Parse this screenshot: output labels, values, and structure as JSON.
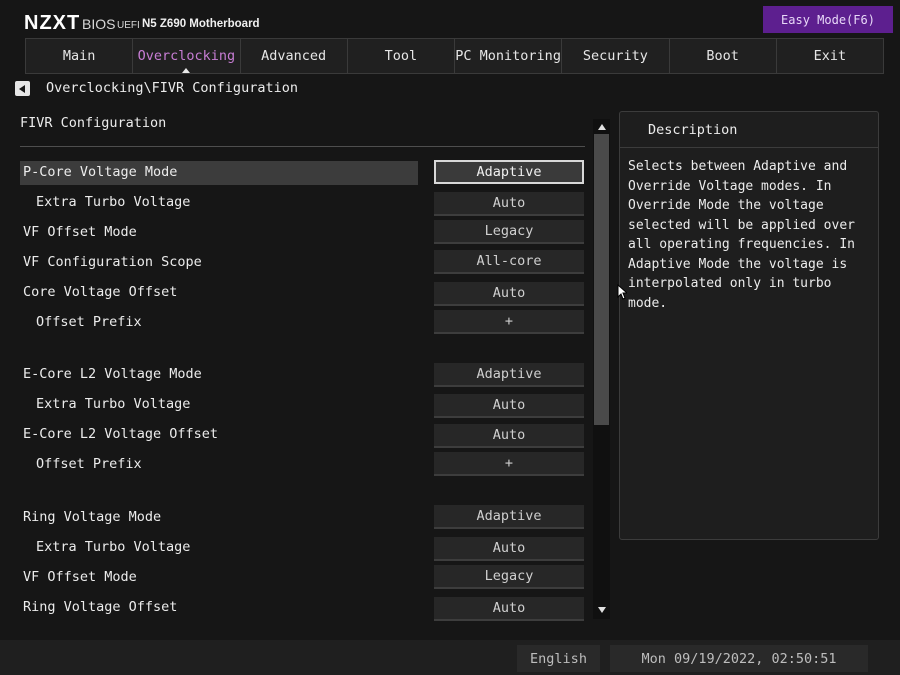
{
  "header": {
    "brand": "NZXT",
    "bios_word": "BIOS",
    "uefi": "UEFI",
    "model": "N5 Z690 Motherboard",
    "easy_mode": "Easy Mode(F6)"
  },
  "tabs": [
    {
      "label": "Main",
      "active": false
    },
    {
      "label": "Overclocking",
      "active": true
    },
    {
      "label": "Advanced",
      "active": false
    },
    {
      "label": "Tool",
      "active": false
    },
    {
      "label": "PC Monitoring",
      "active": false
    },
    {
      "label": "Security",
      "active": false
    },
    {
      "label": "Boot",
      "active": false
    },
    {
      "label": "Exit",
      "active": false
    }
  ],
  "breadcrumb": "Overclocking\\FIVR Configuration",
  "section_title": "FIVR Configuration",
  "settings": [
    {
      "label": "P-Core Voltage Mode",
      "value": "Adaptive",
      "selected": true
    },
    {
      "label": "Extra Turbo Voltage",
      "value": "Auto"
    },
    {
      "label": "VF Offset Mode",
      "value": "Legacy"
    },
    {
      "label": "VF Configuration Scope",
      "value": "All-core"
    },
    {
      "label": "Core Voltage Offset",
      "value": "Auto"
    },
    {
      "label": "Offset Prefix",
      "value": "+"
    },
    {
      "label": "E-Core L2 Voltage Mode",
      "value": "Adaptive"
    },
    {
      "label": "Extra Turbo Voltage",
      "value": "Auto"
    },
    {
      "label": "E-Core L2 Voltage Offset",
      "value": "Auto"
    },
    {
      "label": "Offset Prefix",
      "value": "+"
    },
    {
      "label": "Ring Voltage Mode",
      "value": "Adaptive"
    },
    {
      "label": "Extra Turbo Voltage",
      "value": "Auto"
    },
    {
      "label": "VF Offset Mode",
      "value": "Legacy"
    },
    {
      "label": "Ring Voltage Offset",
      "value": "Auto"
    }
  ],
  "description": {
    "title": "Description",
    "text": "Selects between Adaptive and Override Voltage modes. In Override Mode the voltage selected will be applied over all operating frequencies. In Adaptive Mode the voltage is interpolated only in turbo mode."
  },
  "footer": {
    "language": "English",
    "datetime": "Mon 09/19/2022, 02:50:51"
  },
  "colors": {
    "accent_purple": "#5d1f8f",
    "active_tab_text": "#c77dd4",
    "background": "#161616"
  }
}
